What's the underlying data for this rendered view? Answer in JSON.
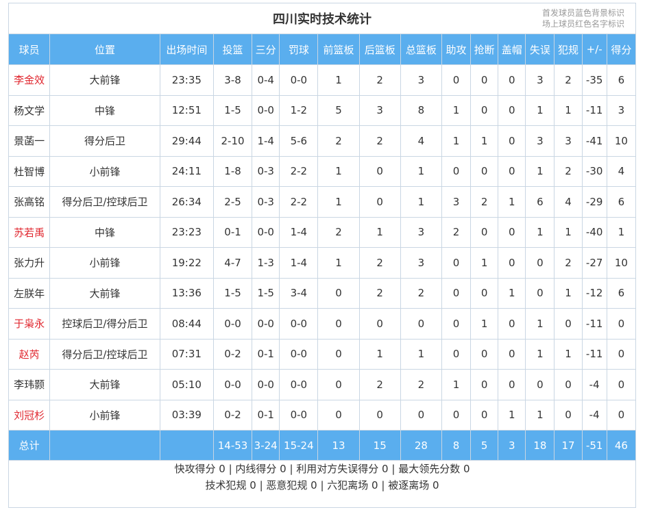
{
  "title": "四川实时技术统计",
  "legend": [
    "首发球员蓝色背景标识",
    "场上球员红色名字标识"
  ],
  "headers": [
    "球员",
    "位置",
    "出场时间",
    "投篮",
    "三分",
    "罚球",
    "前篮板",
    "后篮板",
    "总篮板",
    "助攻",
    "抢断",
    "盖帽",
    "失误",
    "犯规",
    "+/-",
    "得分"
  ],
  "players": [
    {
      "name": "李金效",
      "on_court": true,
      "cells": [
        "大前锋",
        "23:35",
        "3-8",
        "0-4",
        "0-0",
        "1",
        "2",
        "3",
        "0",
        "0",
        "0",
        "3",
        "2",
        "-35",
        "6"
      ]
    },
    {
      "name": "杨文学",
      "on_court": false,
      "cells": [
        "中锋",
        "12:51",
        "1-5",
        "0-0",
        "1-2",
        "5",
        "3",
        "8",
        "1",
        "0",
        "0",
        "1",
        "1",
        "-11",
        "3"
      ]
    },
    {
      "name": "景菡一",
      "on_court": false,
      "cells": [
        "得分后卫",
        "29:44",
        "2-10",
        "1-4",
        "5-6",
        "2",
        "2",
        "4",
        "1",
        "1",
        "0",
        "3",
        "3",
        "-41",
        "10"
      ]
    },
    {
      "name": "杜智博",
      "on_court": false,
      "cells": [
        "小前锋",
        "24:11",
        "1-8",
        "0-3",
        "2-2",
        "1",
        "0",
        "1",
        "0",
        "0",
        "0",
        "1",
        "2",
        "-30",
        "4"
      ]
    },
    {
      "name": "张高铭",
      "on_court": false,
      "cells": [
        "得分后卫/控球后卫",
        "26:34",
        "2-5",
        "0-3",
        "2-2",
        "1",
        "0",
        "1",
        "3",
        "2",
        "1",
        "6",
        "4",
        "-29",
        "6"
      ]
    },
    {
      "name": "苏若禹",
      "on_court": true,
      "cells": [
        "中锋",
        "23:23",
        "0-1",
        "0-0",
        "1-4",
        "2",
        "1",
        "3",
        "2",
        "0",
        "0",
        "1",
        "1",
        "-40",
        "1"
      ]
    },
    {
      "name": "张力升",
      "on_court": false,
      "cells": [
        "小前锋",
        "19:22",
        "4-7",
        "1-3",
        "1-4",
        "1",
        "2",
        "3",
        "0",
        "1",
        "0",
        "0",
        "2",
        "-27",
        "10"
      ]
    },
    {
      "name": "左朕年",
      "on_court": false,
      "cells": [
        "大前锋",
        "13:36",
        "1-5",
        "1-5",
        "3-4",
        "0",
        "2",
        "2",
        "0",
        "0",
        "1",
        "0",
        "1",
        "-12",
        "6"
      ]
    },
    {
      "name": "于枭永",
      "on_court": true,
      "cells": [
        "控球后卫/得分后卫",
        "08:44",
        "0-0",
        "0-0",
        "0-0",
        "0",
        "0",
        "0",
        "0",
        "1",
        "0",
        "1",
        "0",
        "-11",
        "0"
      ]
    },
    {
      "name": "赵芮",
      "on_court": true,
      "cells": [
        "得分后卫/控球后卫",
        "07:31",
        "0-2",
        "0-1",
        "0-0",
        "0",
        "1",
        "1",
        "0",
        "0",
        "0",
        "1",
        "1",
        "-11",
        "0"
      ]
    },
    {
      "name": "李玮颢",
      "on_court": false,
      "cells": [
        "大前锋",
        "05:10",
        "0-0",
        "0-0",
        "0-0",
        "0",
        "2",
        "2",
        "1",
        "0",
        "0",
        "0",
        "0",
        "-4",
        "0"
      ]
    },
    {
      "name": "刘冠杉",
      "on_court": true,
      "cells": [
        "小前锋",
        "03:39",
        "0-2",
        "0-1",
        "0-0",
        "0",
        "0",
        "0",
        "0",
        "0",
        "1",
        "1",
        "0",
        "-4",
        "0"
      ]
    }
  ],
  "totals": [
    "总计",
    "",
    "",
    "14-53",
    "3-24",
    "15-24",
    "13",
    "15",
    "28",
    "8",
    "5",
    "3",
    "18",
    "17",
    "-51",
    "46"
  ],
  "summary": [
    "快攻得分 0 | 内线得分 0 | 利用对方失误得分 0 | 最大领先分数 0",
    "技术犯规 0 | 恶意犯规 0 | 六犯离场 0 | 被逐离场 0"
  ],
  "colors": {
    "header_bg": "#5aaeee",
    "on_court_name": "#e0262e",
    "border": "#c9d6e3"
  }
}
